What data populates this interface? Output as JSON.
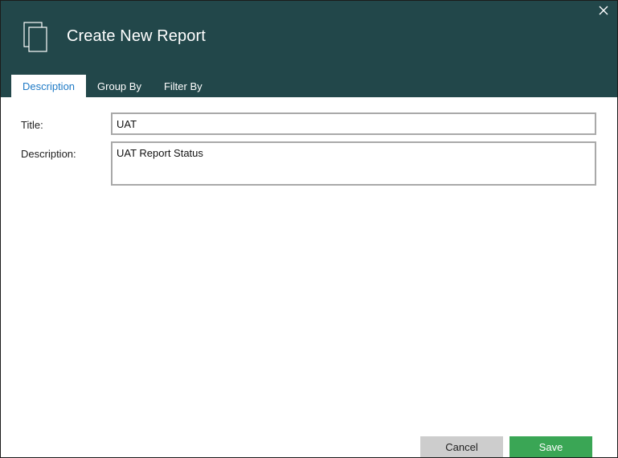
{
  "dialog": {
    "title": "Create New Report",
    "icon": "document-stack-icon",
    "close_icon": "close-icon"
  },
  "tabs": [
    {
      "label": "Description",
      "active": true
    },
    {
      "label": "Group By",
      "active": false
    },
    {
      "label": "Filter By",
      "active": false
    }
  ],
  "form": {
    "title_label": "Title:",
    "title_value": "UAT",
    "description_label": "Description:",
    "description_value": "UAT Report Status"
  },
  "buttons": {
    "cancel_label": "Cancel",
    "save_label": "Save"
  },
  "colors": {
    "header_bg": "#22474a",
    "active_tab_text": "#1e7ac6",
    "save_bg": "#3aa655",
    "cancel_bg": "#cdcdcd"
  }
}
